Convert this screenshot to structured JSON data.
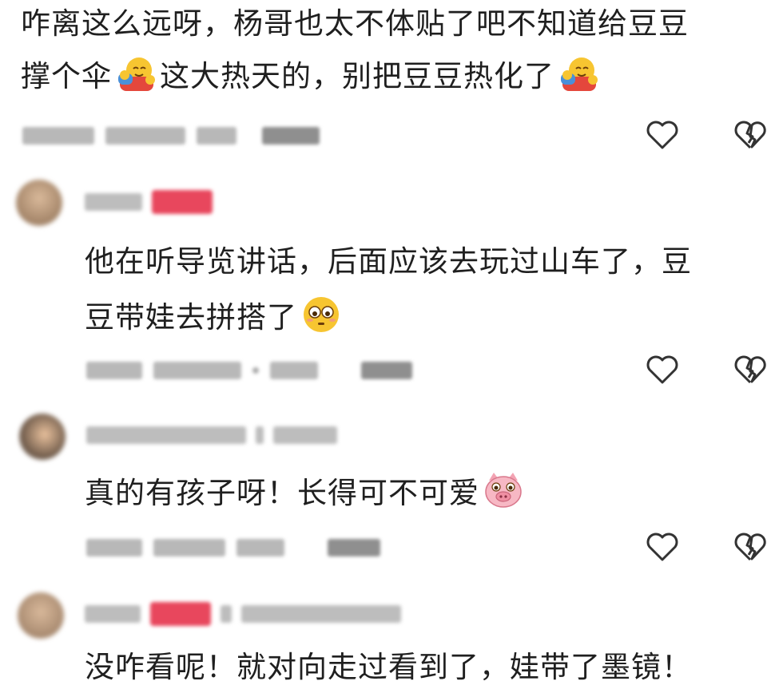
{
  "comments": [
    {
      "lines": [
        "咋离这么远呀，杨哥也太不体贴了吧不知道给豆豆"
      ],
      "line2_parts": [
        "撑个伞",
        "这大热天的，别把豆豆热化了"
      ],
      "emoji": "hugging-face-icon"
    },
    {
      "lines": [
        "他在听导览讲话，后面应该去玩过山车了，豆"
      ],
      "line2_parts": [
        "豆带娃去拼搭了"
      ],
      "emoji": "flushed-face-icon"
    },
    {
      "lines": [],
      "line2_parts": [
        "真的有孩子呀！长得可不可爱"
      ],
      "emoji": "pig-face-icon"
    },
    {
      "lines": [
        "没咋看呢！就对向走过看到了，娃带了墨镜！"
      ],
      "line2_parts": [],
      "emoji": ""
    }
  ],
  "icons": {
    "like": "heart-outline-icon",
    "dislike": "broken-heart-icon"
  },
  "colors": {
    "badge": "#e8475d",
    "icon_stroke": "#333333"
  }
}
